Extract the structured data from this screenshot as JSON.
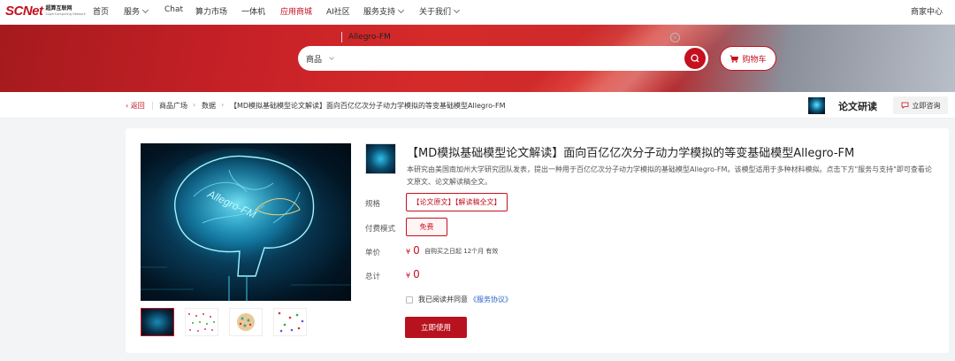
{
  "brand": {
    "logo": "SCNet",
    "sub_cn": "超算互联网",
    "sub_en": "SuperComputing Network"
  },
  "nav": {
    "items": [
      {
        "label": "首页"
      },
      {
        "label": "服务",
        "has_dropdown": true
      },
      {
        "label": "Chat"
      },
      {
        "label": "算力市场"
      },
      {
        "label": "一体机"
      },
      {
        "label": "应用商城",
        "active": true
      },
      {
        "label": "AI社区"
      },
      {
        "label": "服务支持",
        "has_dropdown": true
      },
      {
        "label": "关于我们",
        "has_dropdown": true
      }
    ],
    "merchant_center": "商家中心"
  },
  "search": {
    "category": "商品",
    "query": "Allegro-FM",
    "cart_label": "购物车"
  },
  "breadcrumb": {
    "back": "返回",
    "items": [
      "商品广场",
      "数据",
      "【MD模拟基础模型论文解读】面向百亿亿次分子动力学模拟的等变基础模型Allegro-FM"
    ]
  },
  "shop": {
    "name": "论文研读",
    "consult_label": "立即咨询"
  },
  "product": {
    "title": "【MD模拟基础模型论文解读】面向百亿亿次分子动力学模拟的等变基础模型Allegro-FM",
    "description": "本研究由美国南加州大学研究团队发表，提出一种用于百亿亿次分子动力学模拟的基础模型Allegro-FM。该模型适用于多种材料模拟。点击下方\"服务与支持\"即可查看论文原文、论文解读稿全文。",
    "spec_label": "规格",
    "spec_value": "【论文原文】【解读稿全文】",
    "pay_label": "付费模式",
    "pay_value": "免费",
    "unit_price_label": "单价",
    "currency": "¥",
    "unit_price": "0",
    "validity": "自购买之日起 12个月 有效",
    "total_label": "总计",
    "total": "0",
    "agree_text": "我已阅读并同意",
    "agree_link": "《服务协议》",
    "use_button": "立即使用",
    "image_text": "Allegro-FM"
  },
  "colors": {
    "accent": "#c4101f",
    "link": "#2a63c4"
  }
}
